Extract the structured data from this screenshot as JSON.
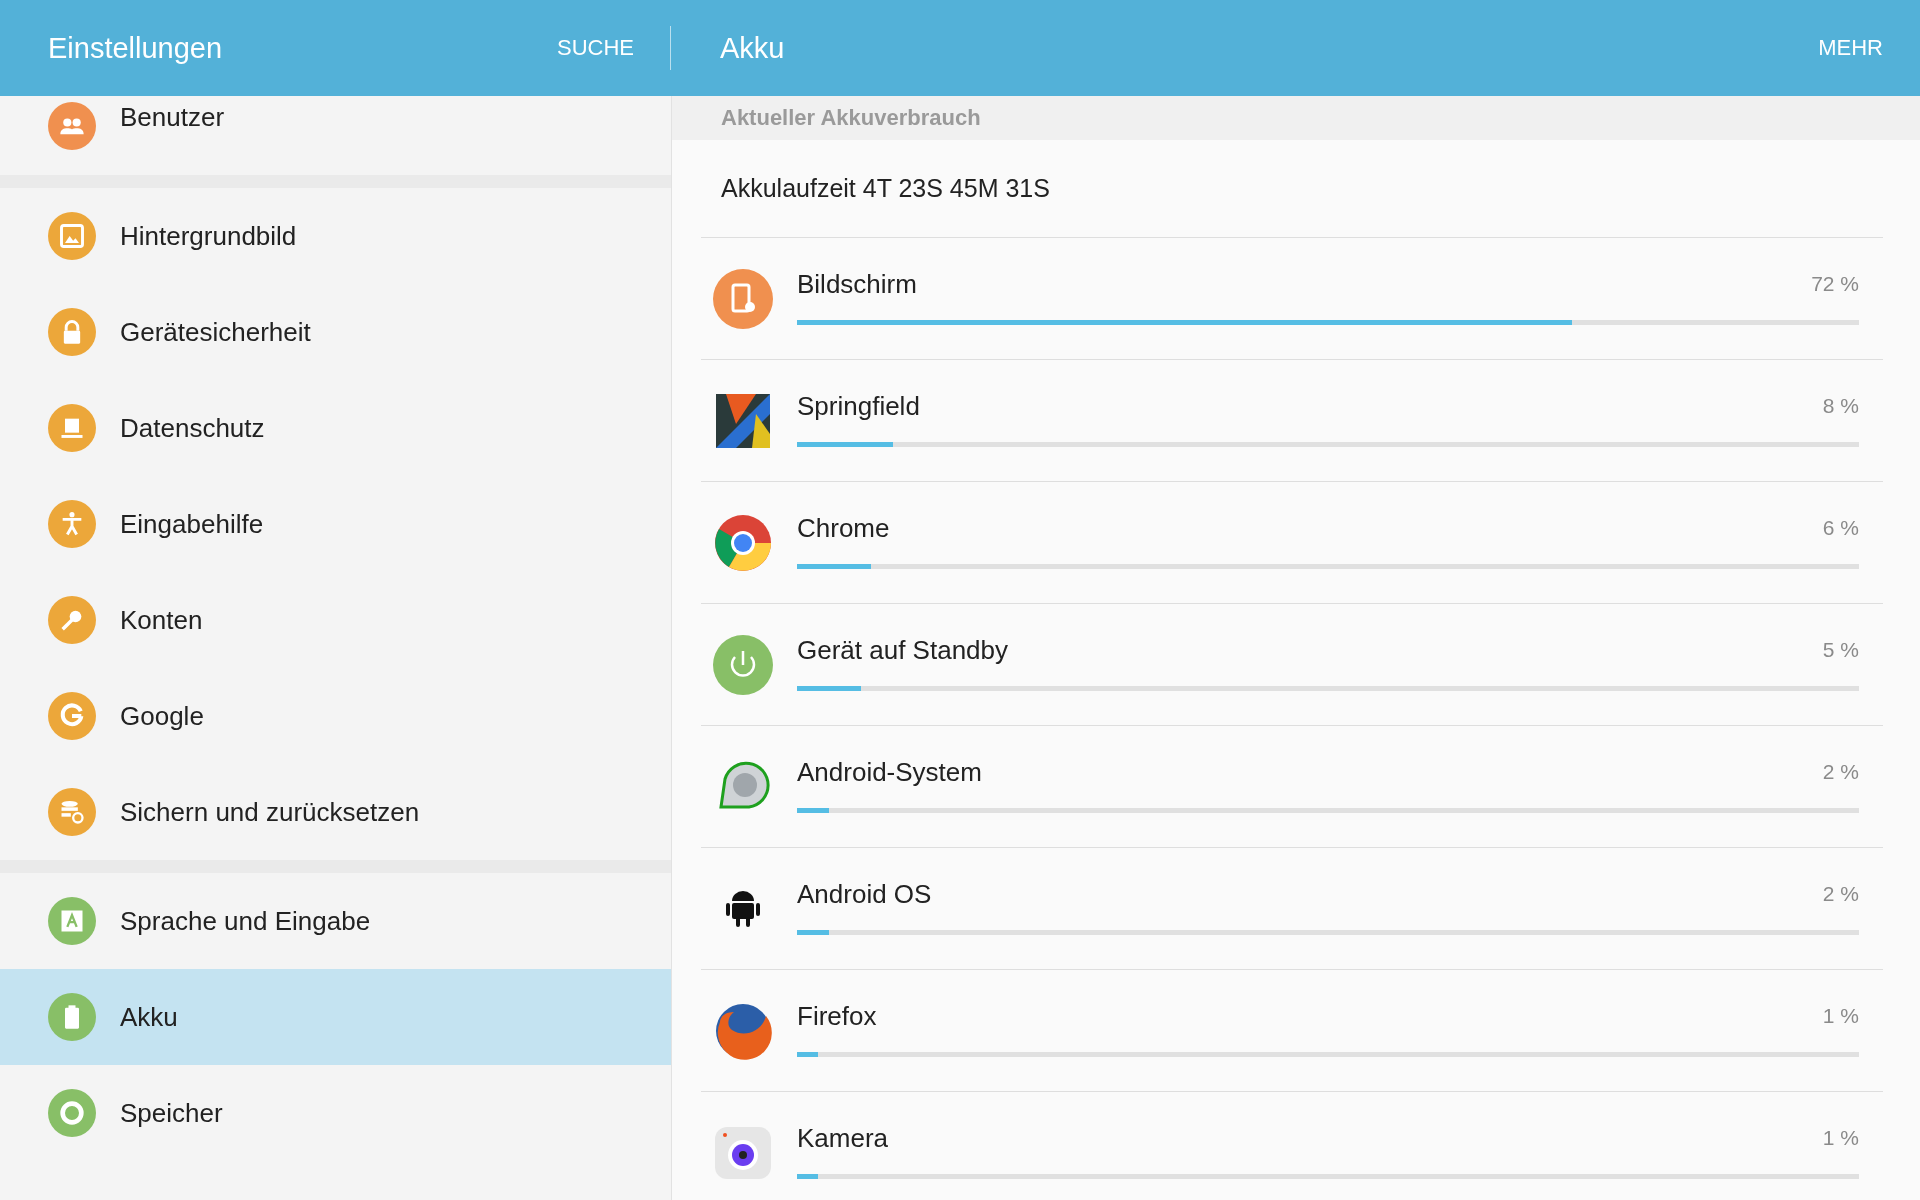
{
  "header": {
    "title": "Einstellungen",
    "search": "SUCHE",
    "page_title": "Akku",
    "more": "MEHR"
  },
  "sidebar": {
    "groups": [
      {
        "items": [
          {
            "label": "Benutzer",
            "kind": "users",
            "color": "#f0904f",
            "selected": false
          }
        ]
      },
      {
        "items": [
          {
            "label": "Hintergrundbild",
            "kind": "image",
            "color": "#eca73a",
            "selected": false
          },
          {
            "label": "Gerätesicherheit",
            "kind": "lock",
            "color": "#eca73a",
            "selected": false
          },
          {
            "label": "Datenschutz",
            "kind": "privacy",
            "color": "#eca73a",
            "selected": false
          },
          {
            "label": "Eingabehilfe",
            "kind": "accessibility",
            "color": "#eca73a",
            "selected": false
          },
          {
            "label": "Konten",
            "kind": "key",
            "color": "#eca73a",
            "selected": false
          },
          {
            "label": "Google",
            "kind": "google",
            "color": "#eca73a",
            "selected": false
          },
          {
            "label": "Sichern und zurücksetzen",
            "kind": "backup",
            "color": "#eca73a",
            "selected": false
          }
        ]
      },
      {
        "items": [
          {
            "label": "Sprache und Eingabe",
            "kind": "language",
            "color": "#88bf67",
            "selected": false
          },
          {
            "label": "Akku",
            "kind": "battery",
            "color": "#88bf67",
            "selected": true
          },
          {
            "label": "Speicher",
            "kind": "storage",
            "color": "#88bf67",
            "selected": false
          }
        ]
      }
    ]
  },
  "battery": {
    "section": "Aktueller Akkuverbrauch",
    "runtime": "Akkulaufzeit 4T 23S 45M 31S",
    "usage": [
      {
        "name": "Bildschirm",
        "percent": "72 %",
        "level": 0.73,
        "kind": "screen"
      },
      {
        "name": "Springfield",
        "percent": "8 %",
        "level": 0.09,
        "kind": "game"
      },
      {
        "name": "Chrome",
        "percent": "6 %",
        "level": 0.07,
        "kind": "chrome"
      },
      {
        "name": "Gerät auf Standby",
        "percent": "5 %",
        "level": 0.06,
        "kind": "standby"
      },
      {
        "name": "Android-System",
        "percent": "2 %",
        "level": 0.03,
        "kind": "system"
      },
      {
        "name": "Android OS",
        "percent": "2 %",
        "level": 0.03,
        "kind": "android"
      },
      {
        "name": "Firefox",
        "percent": "1 %",
        "level": 0.02,
        "kind": "firefox"
      },
      {
        "name": "Kamera",
        "percent": "1 %",
        "level": 0.02,
        "kind": "camera"
      }
    ]
  }
}
